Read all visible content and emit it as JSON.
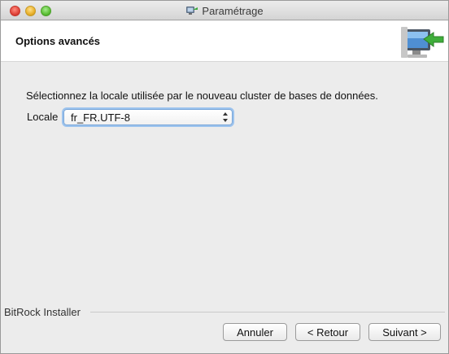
{
  "window": {
    "title": "Paramétrage",
    "title_icon": "installer-icon"
  },
  "header": {
    "title": "Options avancés",
    "icon": "computer-arrow-icon"
  },
  "main": {
    "description": "Sélectionnez la locale utilisée par le nouveau cluster de bases de données.",
    "locale_label": "Locale",
    "locale_value": "fr_FR.UTF-8"
  },
  "footer": {
    "brand": "BitRock Installer",
    "cancel_label": "Annuler",
    "back_label": "< Retour",
    "next_label": "Suivant >"
  },
  "colors": {
    "focus_ring": "#9cc3ee",
    "window_bg": "#ececec",
    "header_bg": "#ffffff"
  }
}
